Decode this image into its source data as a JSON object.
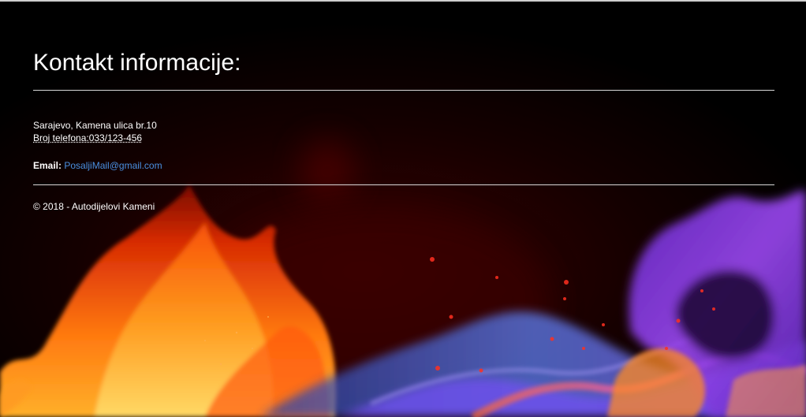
{
  "page": {
    "title": "Kontakt informacije:"
  },
  "contact": {
    "address": "Sarajevo, Kamena ulica br.10",
    "phone": "Broj telefona:033/123-456",
    "email_label": "Email:",
    "email": "PosaljiMail@gmail.com"
  },
  "footer": {
    "copyright": "© 2018 - Autodijelovi Kameni"
  },
  "background": {
    "image": "fire-and-smoke-flames",
    "colors": {
      "base": "#000000",
      "fire_orange": "#ff7a10",
      "fire_red": "#d81e05",
      "smoke_purple": "#8a3df0",
      "smoke_blue": "#4d6fe8"
    }
  }
}
